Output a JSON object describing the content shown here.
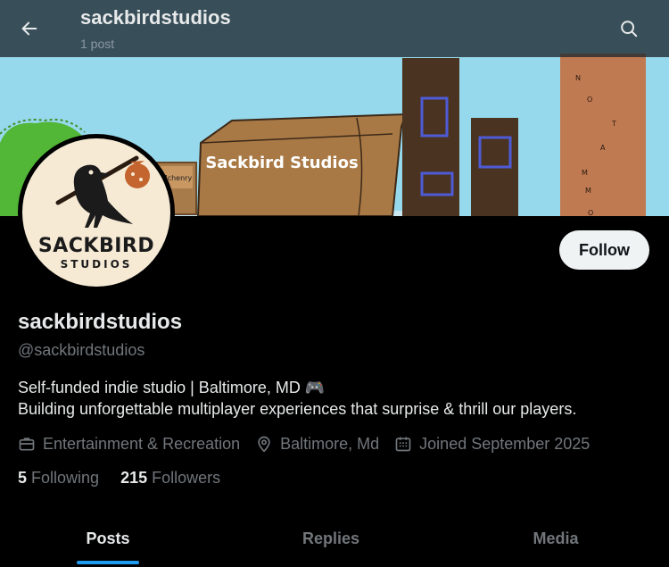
{
  "header": {
    "title": "sackbirdstudios",
    "post_count": "1 post",
    "back_icon": "arrow-left-icon",
    "search_icon": "search-icon"
  },
  "banner": {
    "box_text": "Sackbird Studios",
    "sign_text": "Mchenry",
    "tower_text": [
      "N",
      "O",
      "T",
      "A",
      "M",
      "M",
      "O"
    ]
  },
  "avatar": {
    "logo_line1": "SACKBIRD",
    "logo_line2": "STUDIOS"
  },
  "actions": {
    "follow_label": "Follow"
  },
  "profile": {
    "display_name": "sackbirdstudios",
    "handle": "@sackbirdstudios",
    "bio_line1": "Self-funded indie studio | Baltimore, MD 🎮",
    "bio_line2": "Building unforgettable multiplayer experiences that surprise & thrill our players.",
    "category": "Entertainment & Recreation",
    "location": "Baltimore, Md",
    "joined": "Joined September 2025",
    "category_icon": "briefcase-icon",
    "location_icon": "location-pin-icon",
    "joined_icon": "calendar-icon"
  },
  "stats": {
    "following_count": "5",
    "following_label": "Following",
    "followers_count": "215",
    "followers_label": "Followers"
  },
  "tabs": [
    {
      "label": "Posts",
      "active": true
    },
    {
      "label": "Replies",
      "active": false
    },
    {
      "label": "Media",
      "active": false
    }
  ],
  "colors": {
    "accent": "#1d9bf0",
    "background": "#000000",
    "text_primary": "#e7e9ea",
    "text_secondary": "#71767b"
  }
}
